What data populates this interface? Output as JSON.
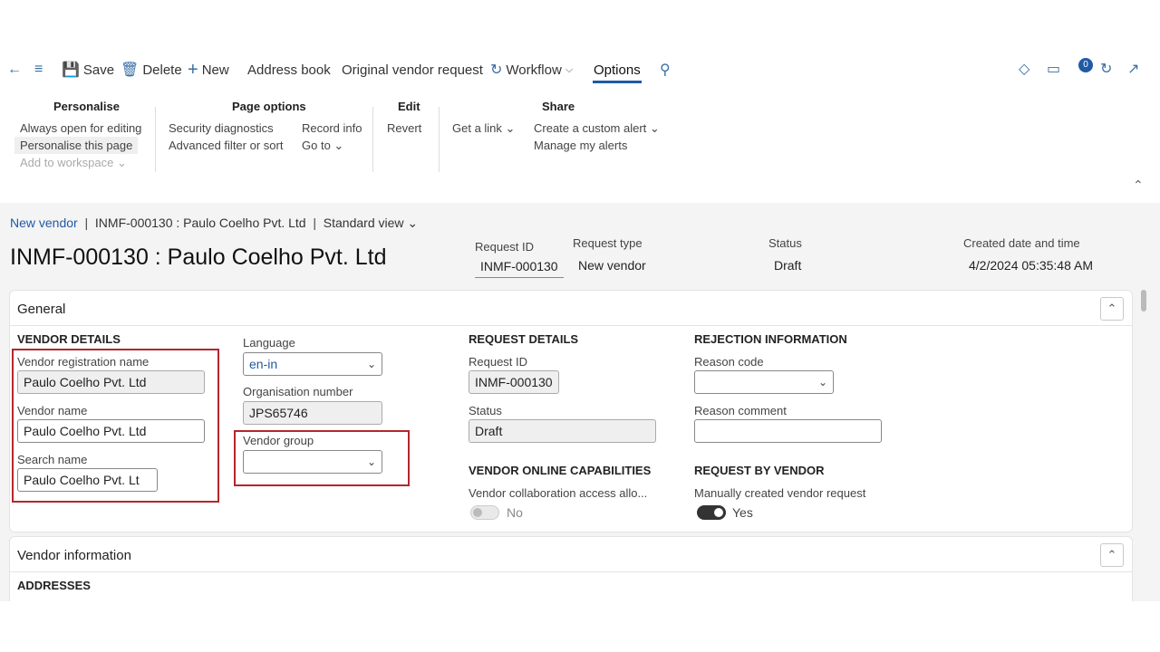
{
  "actionbar": {
    "save": "Save",
    "delete": "Delete",
    "new": "New",
    "address_book": "Address book",
    "original_vendor_request": "Original vendor request",
    "workflow": "Workflow",
    "options": "Options",
    "notification_count": "0"
  },
  "ribbon": {
    "personalise": {
      "title": "Personalise",
      "always_open": "Always open for editing",
      "personalise_page": "Personalise this page",
      "add_to_workspace": "Add to workspace"
    },
    "page_options": {
      "title": "Page options",
      "security_diagnostics": "Security diagnostics",
      "advanced_filter": "Advanced filter or sort",
      "record_info": "Record info",
      "go_to": "Go to"
    },
    "edit": {
      "title": "Edit",
      "revert": "Revert"
    },
    "share": {
      "title": "Share",
      "get_link": "Get a link",
      "custom_alert": "Create a custom alert",
      "manage_alerts": "Manage my alerts"
    }
  },
  "breadcrumb": {
    "root": "New vendor",
    "record": "INMF-000130 : Paulo Coelho Pvt. Ltd",
    "view": "Standard view"
  },
  "header": {
    "title": "INMF-000130 : Paulo Coelho Pvt. Ltd",
    "request_id_label": "Request ID",
    "request_id": "INMF-000130",
    "request_type_label": "Request type",
    "request_type": "New vendor",
    "status_label": "Status",
    "status": "Draft",
    "created_label": "Created date and time",
    "created": "4/2/2024 05:35:48 AM"
  },
  "general": {
    "title": "General",
    "vendor_details": {
      "title": "VENDOR DETAILS",
      "reg_name_label": "Vendor registration name",
      "reg_name": "Paulo Coelho Pvt. Ltd",
      "vendor_name_label": "Vendor name",
      "vendor_name": "Paulo Coelho Pvt. Ltd",
      "search_name_label": "Search name",
      "search_name": "Paulo Coelho Pvt. Lt"
    },
    "language_label": "Language",
    "language": "en-in",
    "org_number_label": "Organisation number",
    "org_number": "JPS65746",
    "vendor_group_label": "Vendor group",
    "vendor_group": "",
    "request_details": {
      "title": "REQUEST DETAILS",
      "request_id_label": "Request ID",
      "request_id": "INMF-000130",
      "status_label": "Status",
      "status": "Draft"
    },
    "online": {
      "title": "VENDOR ONLINE CAPABILITIES",
      "access_label": "Vendor collaboration access allo...",
      "access_value": "No"
    },
    "rejection": {
      "title": "REJECTION INFORMATION",
      "reason_code_label": "Reason code",
      "reason_code": "",
      "reason_comment_label": "Reason comment",
      "reason_comment": ""
    },
    "by_vendor": {
      "title": "REQUEST BY VENDOR",
      "manual_label": "Manually created vendor request",
      "manual_value": "Yes"
    }
  },
  "vendor_information": {
    "title": "Vendor information",
    "addresses": "ADDRESSES"
  }
}
